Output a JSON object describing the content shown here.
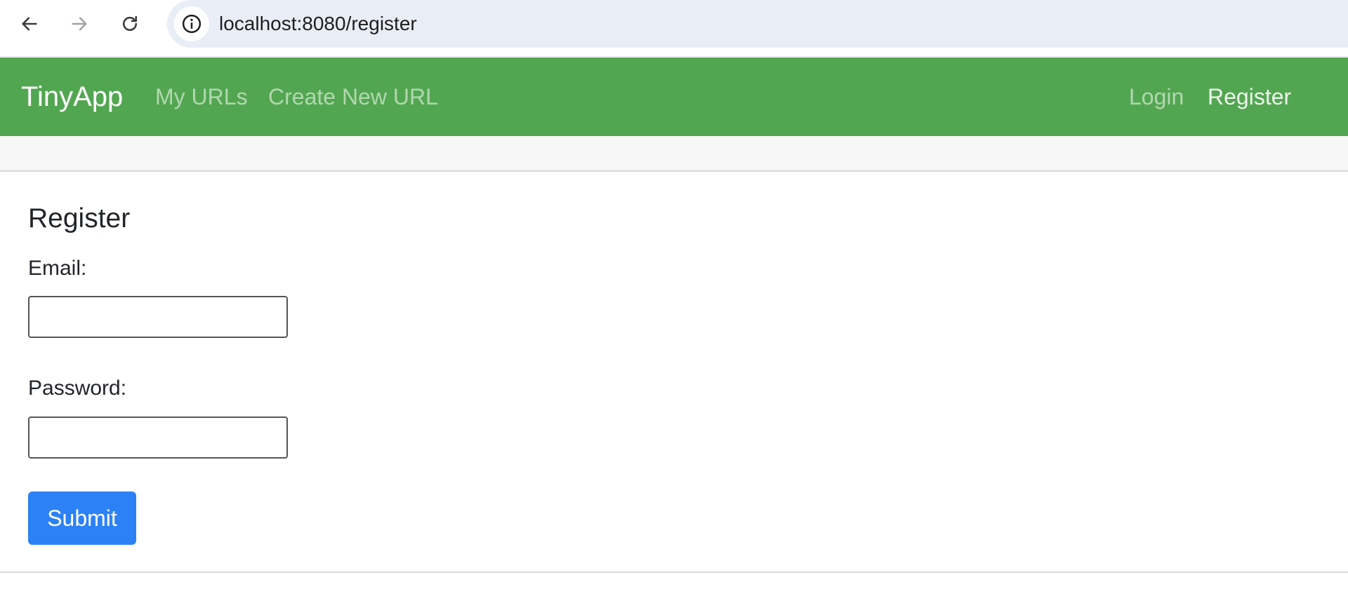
{
  "browser": {
    "url": "localhost:8080/register",
    "icons": {
      "back": "arrow-left-icon",
      "forward": "arrow-right-icon",
      "reload": "reload-icon",
      "site_info": "info-icon"
    }
  },
  "navbar": {
    "brand": "TinyApp",
    "links": [
      {
        "label": "My URLs"
      },
      {
        "label": "Create New URL"
      }
    ],
    "right_links": [
      {
        "label": "Login"
      },
      {
        "label": "Register"
      }
    ],
    "colors": {
      "background": "#53a651",
      "link": "rgba(255,255,255,0.55)",
      "active_link": "#ffffff"
    }
  },
  "form": {
    "title": "Register",
    "email_label": "Email:",
    "email_value": "",
    "password_label": "Password:",
    "password_value": "",
    "submit_label": "Submit",
    "submit_color": "#2d81f7"
  }
}
